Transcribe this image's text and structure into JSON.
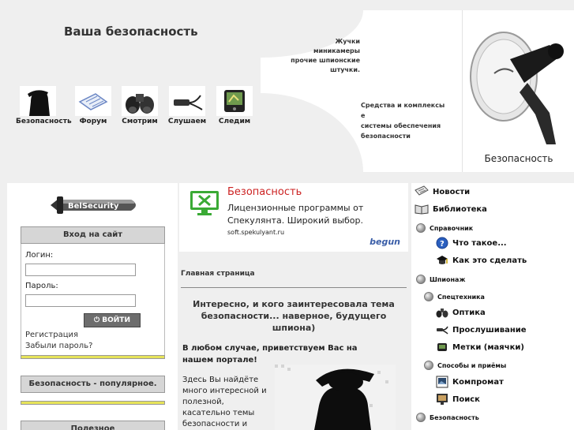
{
  "header": {
    "site_title": "Ваша безопасность",
    "tagline_lines": [
      "Жучки",
      "миникамеры",
      "прочие шпионские",
      "штучки."
    ],
    "tagline2_lines": [
      "Средства и комплексы",
      "е",
      "системы обеспечения",
      "безопасности"
    ],
    "hero_caption": "Безопасность",
    "nav": [
      {
        "label": "Безопасность",
        "icon": "spy-silhouette-icon"
      },
      {
        "label": "Форум",
        "icon": "notebook-icon"
      },
      {
        "label": "Смотрим",
        "icon": "binoculars-icon"
      },
      {
        "label": "Слушаем",
        "icon": "bug-microphone-icon"
      },
      {
        "label": "Следим",
        "icon": "gps-device-icon"
      }
    ]
  },
  "left": {
    "logo_text": "BelSecurity",
    "login": {
      "title": "Вход на сайт",
      "login_label": "Логин:",
      "password_label": "Пароль:",
      "login_value": "",
      "password_value": "",
      "button_label": "ВОЙТИ",
      "register_link": "Регистрация",
      "forgot_link": "Забыли пароль?"
    },
    "popular_title": "Безопасность - популярное.",
    "third_title": "Полезное"
  },
  "center": {
    "ad": {
      "title": "Безопасность",
      "text": "Лицензионные программы от Спекулянта. Широкий выбор.",
      "url": "soft.spekulyant.ru",
      "brand": "begun"
    },
    "breadcrumb": "Главная страница",
    "intro": "Интересно, и кого заинтересовала тема безопасности... наверное, будущего шпиона)",
    "welcome": "В любом случае, приветствуем Вас на нашем портале!",
    "body": "Здесь Вы найдёте много интересной и полезной, касательно темы безопасности и"
  },
  "right_menu": [
    {
      "label": "Новости",
      "icon": "news-icon",
      "level": 0,
      "small": false
    },
    {
      "label": "Библиотека",
      "icon": "book-icon",
      "level": 0,
      "small": false
    },
    {
      "label": "Справочник",
      "icon": "bullet-icon",
      "level": 1,
      "small": true
    },
    {
      "label": "Что такое...",
      "icon": "question-icon",
      "level": 2,
      "small": false
    },
    {
      "label": "Как это сделать",
      "icon": "graduation-cap-icon",
      "level": 2,
      "small": false
    },
    {
      "label": "Шпионаж",
      "icon": "bullet-icon",
      "level": 1,
      "small": true
    },
    {
      "label": "Спецтехника",
      "icon": "bullet-icon",
      "level": 2,
      "small": true
    },
    {
      "label": "Оптика",
      "icon": "binoculars-icon",
      "level": 3,
      "small": false
    },
    {
      "label": "Прослушивание",
      "icon": "bug-icon",
      "level": 3,
      "small": false
    },
    {
      "label": "Метки (маячки)",
      "icon": "tracker-icon",
      "level": 3,
      "small": false
    },
    {
      "label": "Способы и приёмы",
      "icon": "bullet-icon",
      "level": 2,
      "small": true
    },
    {
      "label": "Компромат",
      "icon": "photo-icon",
      "level": 3,
      "small": false
    },
    {
      "label": "Поиск",
      "icon": "monitor-icon",
      "level": 3,
      "small": false
    },
    {
      "label": "Безопасность",
      "icon": "bullet-icon",
      "level": 1,
      "small": true
    }
  ]
}
